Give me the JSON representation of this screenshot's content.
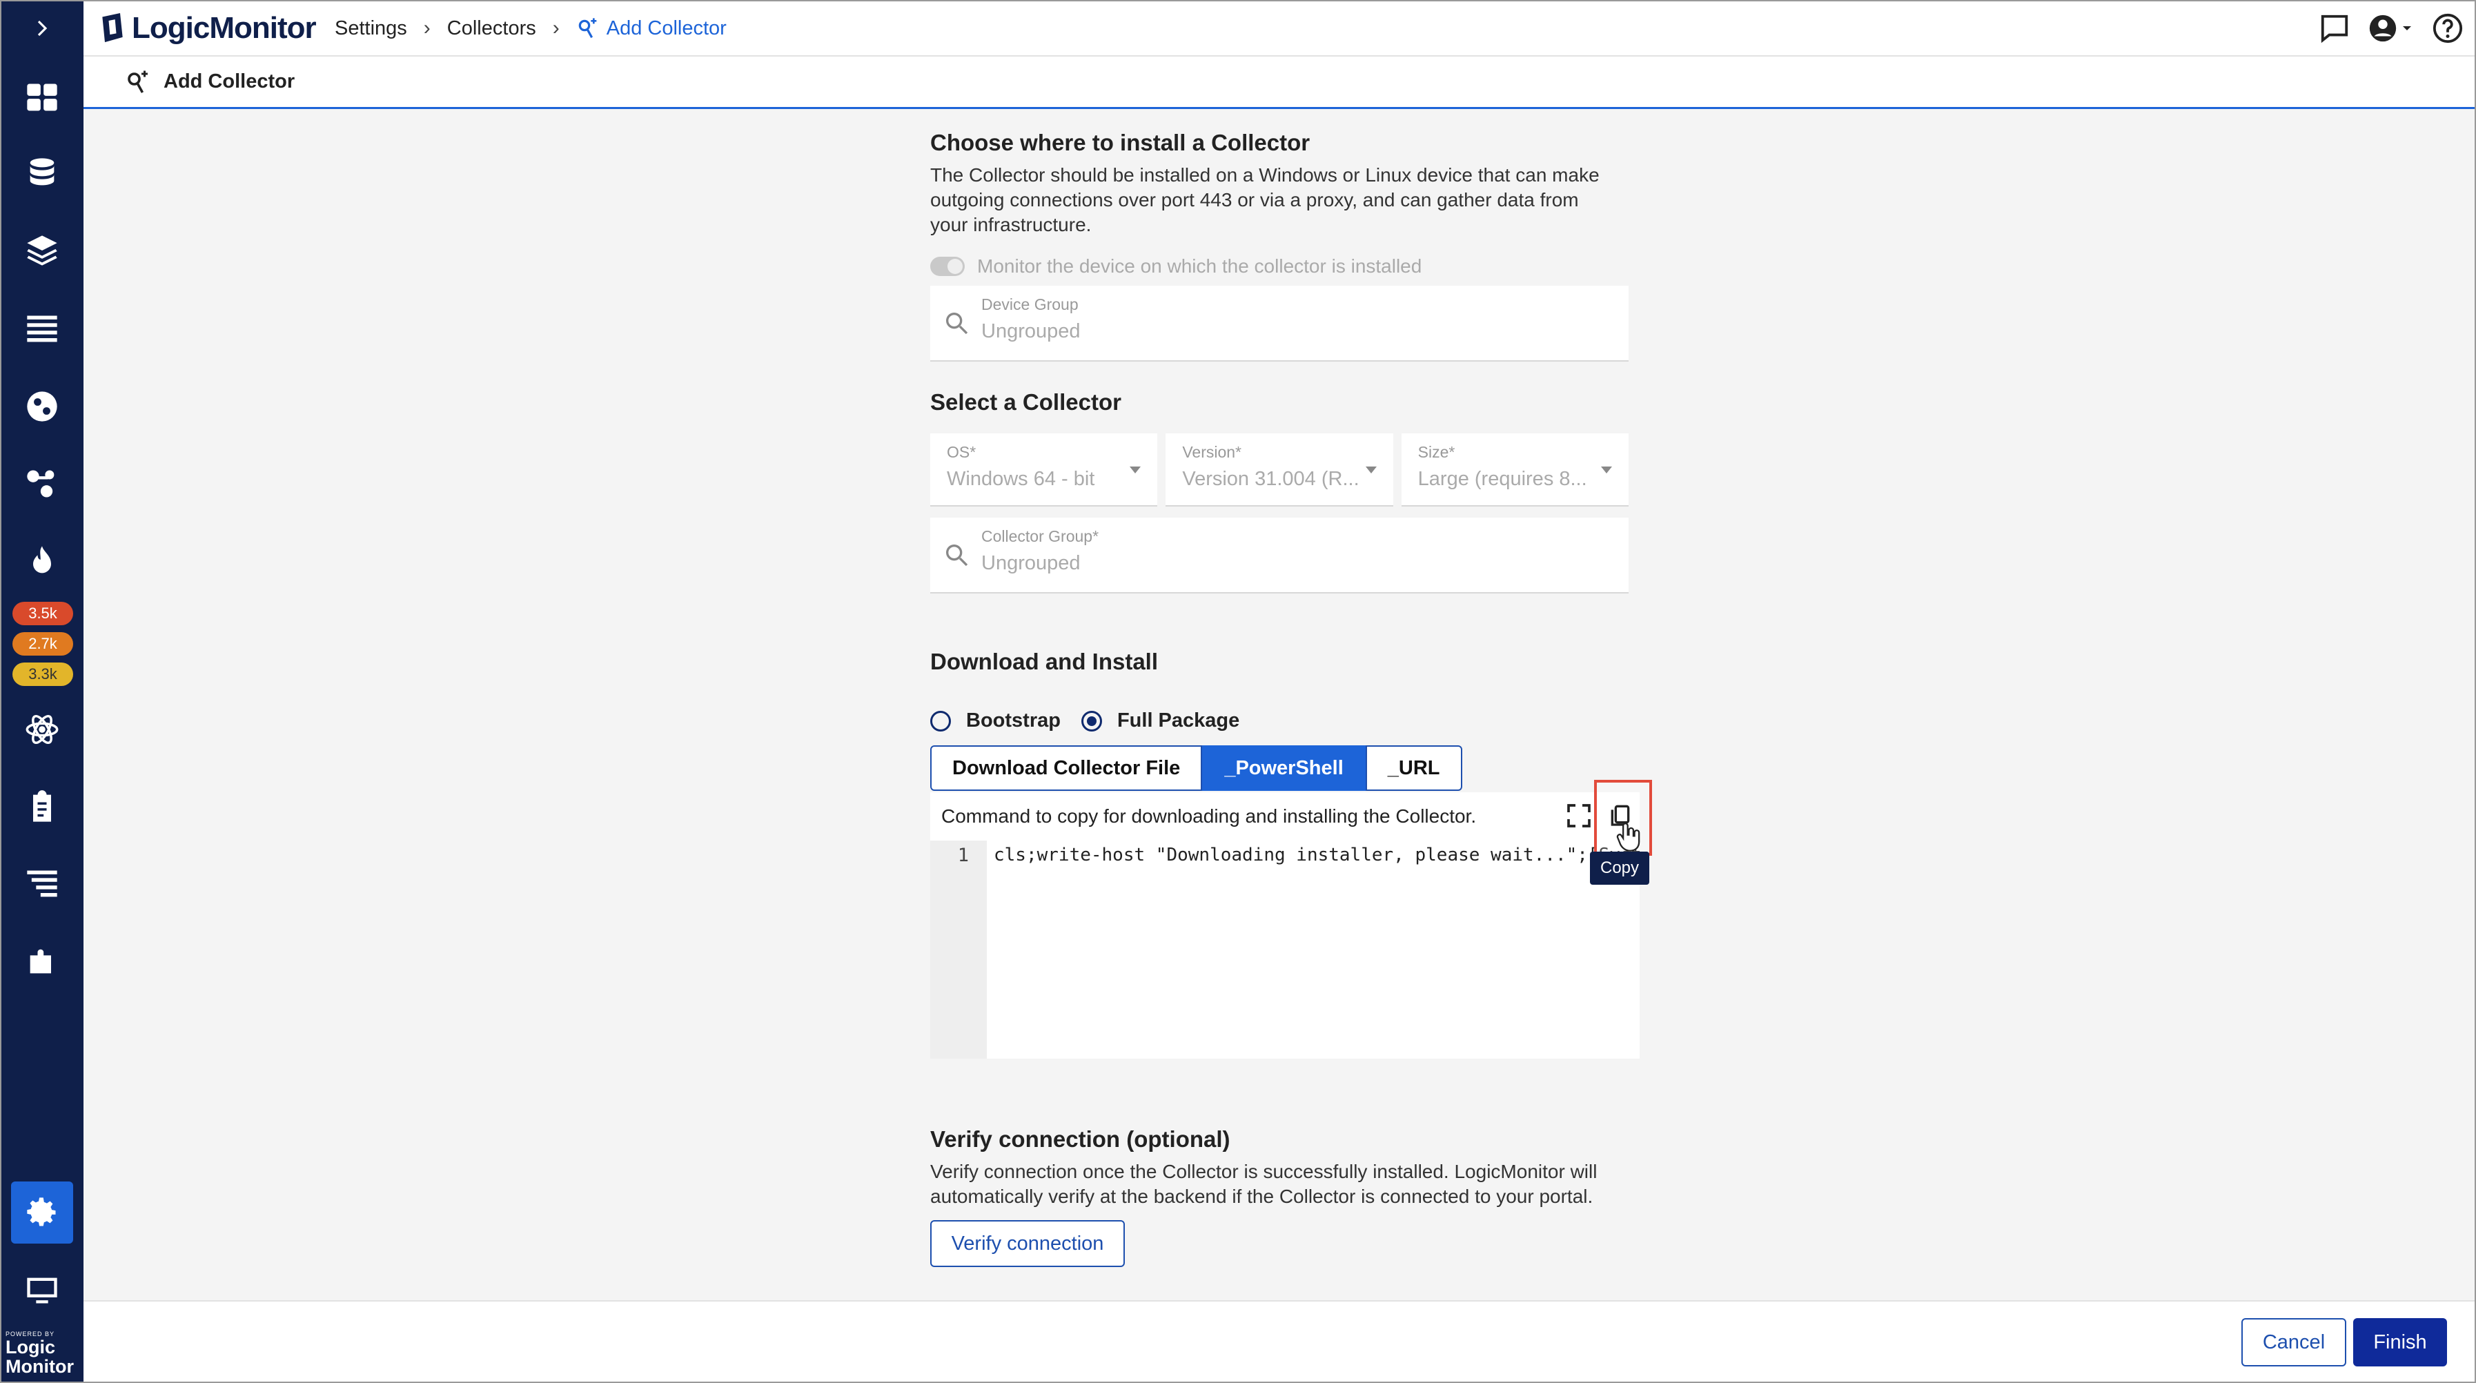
{
  "app": {
    "brand": "LogicMonitor"
  },
  "breadcrumbs": [
    {
      "label": "Settings"
    },
    {
      "label": "Collectors"
    },
    {
      "label": "Add Collector"
    }
  ],
  "subheader": {
    "title": "Add Collector"
  },
  "rail": {
    "badges": [
      {
        "label": "3.5k",
        "color": "#d94a2b"
      },
      {
        "label": "2.7k",
        "color": "#e07a20"
      },
      {
        "label": "3.3k",
        "color": "#e2b52a"
      }
    ],
    "logo_small": "POWERED BY",
    "logo_line1": "Logic",
    "logo_line2": "Monitor"
  },
  "install": {
    "title": "Choose where to install a Collector",
    "description_lines": [
      "The Collector should be installed on a Windows or Linux device that can make",
      "outgoing connections over port 443 or via a proxy, and can gather data from",
      "your infrastructure."
    ],
    "toggle_label": "Monitor the device on which the collector is installed",
    "device_group_label": "Device Group",
    "device_group_value": "Ungrouped"
  },
  "select": {
    "title": "Select a Collector",
    "os_label": "OS*",
    "os_value": "Windows 64 - bit",
    "version_label": "Version*",
    "version_value": "Version 31.004 (R...",
    "size_label": "Size*",
    "size_value": "Large (requires 8...",
    "collector_group_label": "Collector Group*",
    "collector_group_value": "Ungrouped"
  },
  "download": {
    "title": "Download and Install",
    "radio_bootstrap": "Bootstrap",
    "radio_full": "Full Package",
    "tabs": [
      "Download Collector File",
      "_PowerShell",
      "_URL"
    ],
    "command_caption": "Command to copy for downloading and installing the Collector.",
    "line_number": "1",
    "code": "cls;write-host \"Downloading installer, please wait...\";[System",
    "tooltip": "Copy"
  },
  "verify": {
    "title": "Verify connection (optional)",
    "description_lines": [
      "Verify connection once the Collector is successfully installed. LogicMonitor will",
      "automatically verify at the backend if the Collector is connected to your portal."
    ],
    "button": "Verify connection"
  },
  "footer": {
    "cancel": "Cancel",
    "finish": "Finish"
  },
  "colors": {
    "accent": "#1d64d8",
    "rail": "#0f1f4a",
    "primary_button": "#0f2a9a",
    "highlight": "#e24b3b"
  }
}
